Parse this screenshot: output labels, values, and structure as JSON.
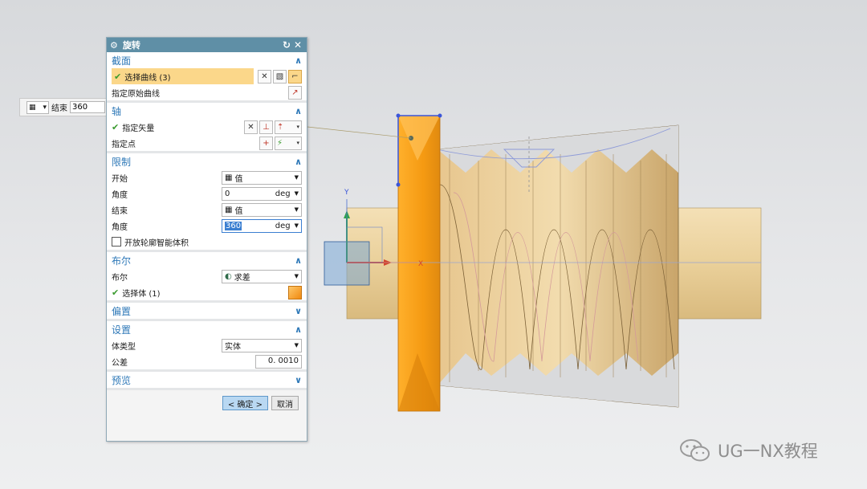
{
  "mini_toolbar": {
    "end_label": "结束",
    "end_value": "360"
  },
  "dialog": {
    "title": "旋转",
    "sections": {
      "section": {
        "title": "截面",
        "select_curve": "选择曲线 (3)",
        "specify_original": "指定原始曲线"
      },
      "axis": {
        "title": "轴",
        "specify_vector": "指定矢量",
        "specify_point": "指定点"
      },
      "limits": {
        "title": "限制",
        "start_label": "开始",
        "start_type": "值",
        "angle1_label": "角度",
        "angle1_value": "0",
        "angle1_unit": "deg",
        "end_label": "结束",
        "end_type": "值",
        "angle2_label": "角度",
        "angle2_value": "360",
        "angle2_unit": "deg",
        "open_profile": "开放轮廓智能体积"
      },
      "boolean": {
        "title": "布尔",
        "bool_label": "布尔",
        "bool_value": "求差",
        "select_body": "选择体 (1)"
      },
      "offset": {
        "title": "偏置"
      },
      "settings": {
        "title": "设置",
        "body_type_label": "体类型",
        "body_type_value": "实体",
        "tolerance_label": "公差",
        "tolerance_value": "0. 0010"
      },
      "preview": {
        "title": "预览"
      }
    },
    "ok_label": "< 确定 >",
    "cancel_label": "取消"
  },
  "watermark": {
    "text": "UG一NX教程"
  },
  "axis_labels": {
    "x": "X",
    "y": "Y"
  },
  "colors": {
    "title_bar": "#5f8fa6",
    "section_header": "#2f79b8",
    "highlight": "#fbd78a",
    "orange_body": "#f5a020",
    "cylinder": "#efd6a4"
  }
}
